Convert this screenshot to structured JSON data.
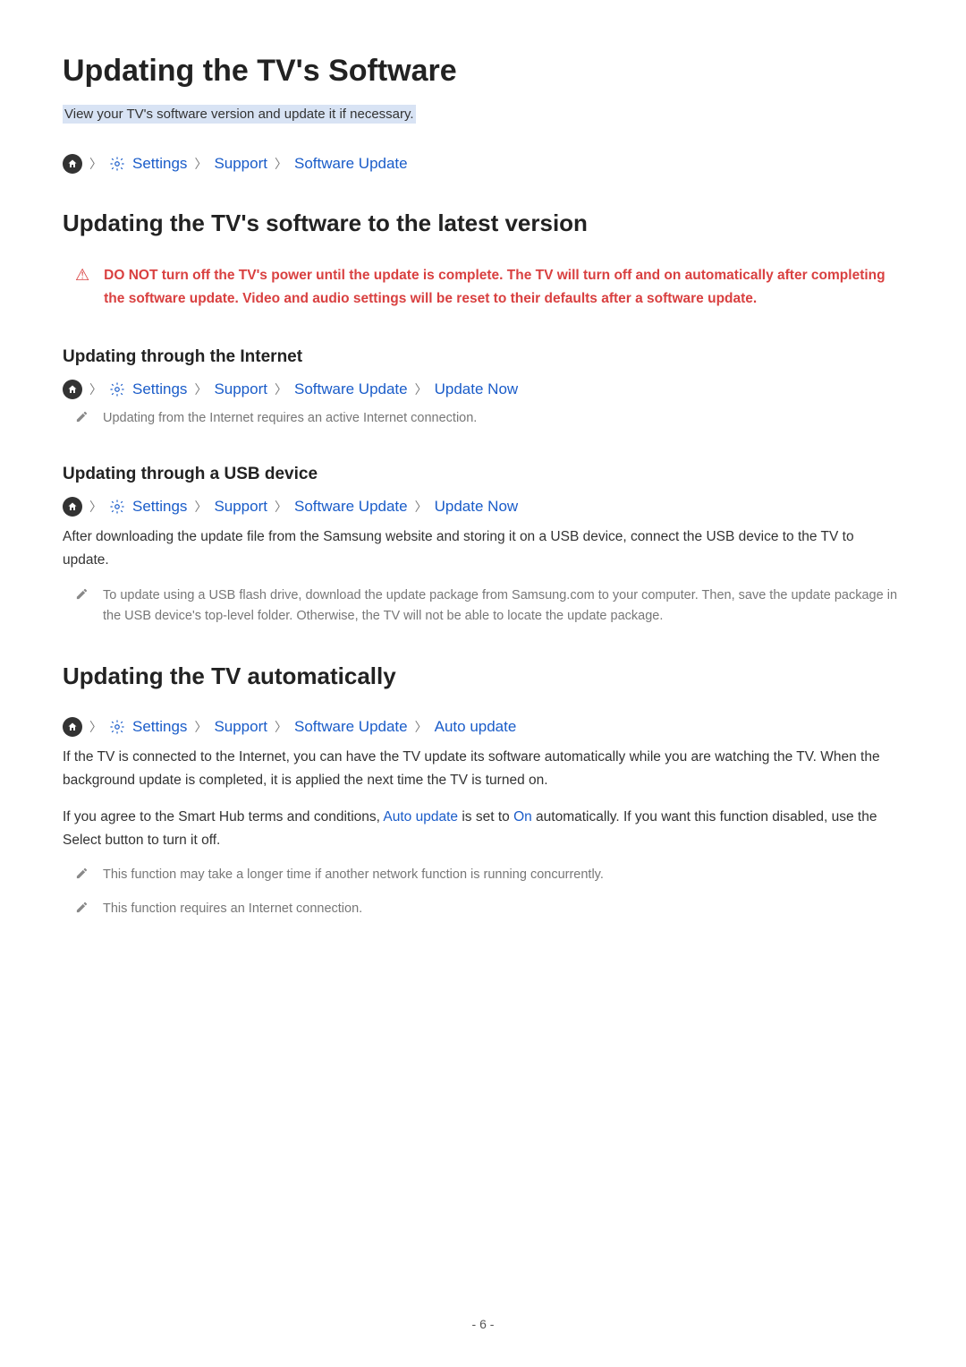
{
  "title": "Updating the TV's Software",
  "subtitle": "View your TV's software version and update it if necessary.",
  "bc1": {
    "settings": "Settings",
    "support": "Support",
    "swupdate": "Software Update"
  },
  "h2_1": "Updating the TV's software to the latest version",
  "warning": "DO NOT turn off the TV's power until the update is complete. The TV will turn off and on automatically after completing the software update. Video and audio settings will be reset to their defaults after a software update.",
  "h3_1": "Updating through the Internet",
  "bc2": {
    "settings": "Settings",
    "support": "Support",
    "swupdate": "Software Update",
    "updatenow": "Update Now"
  },
  "note1": "Updating from the Internet requires an active Internet connection.",
  "h3_2": "Updating through a USB device",
  "bc3": {
    "settings": "Settings",
    "support": "Support",
    "swupdate": "Software Update",
    "updatenow": "Update Now"
  },
  "usb_body": "After downloading the update file from the Samsung website and storing it on a USB device, connect the USB device to the TV to update.",
  "note2": "To update using a USB flash drive, download the update package from Samsung.com to your computer. Then, save the update package in the USB device's top-level folder. Otherwise, the TV will not be able to locate the update package.",
  "h2_2": "Updating the TV automatically",
  "bc4": {
    "settings": "Settings",
    "support": "Support",
    "swupdate": "Software Update",
    "autoupdate": "Auto update"
  },
  "auto_body1": "If the TV is connected to the Internet, you can have the TV update its software automatically while you are watching the TV. When the background update is completed, it is applied the next time the TV is turned on.",
  "auto_body2_pre": "If you agree to the Smart Hub terms and conditions, ",
  "auto_body2_link1": "Auto update",
  "auto_body2_mid": " is set to ",
  "auto_body2_link2": "On",
  "auto_body2_post": " automatically. If you want this function disabled, use the Select button to turn it off.",
  "note3": "This function may take a longer time if another network function is running concurrently.",
  "note4": "This function requires an Internet connection.",
  "page_number": "- 6 -"
}
